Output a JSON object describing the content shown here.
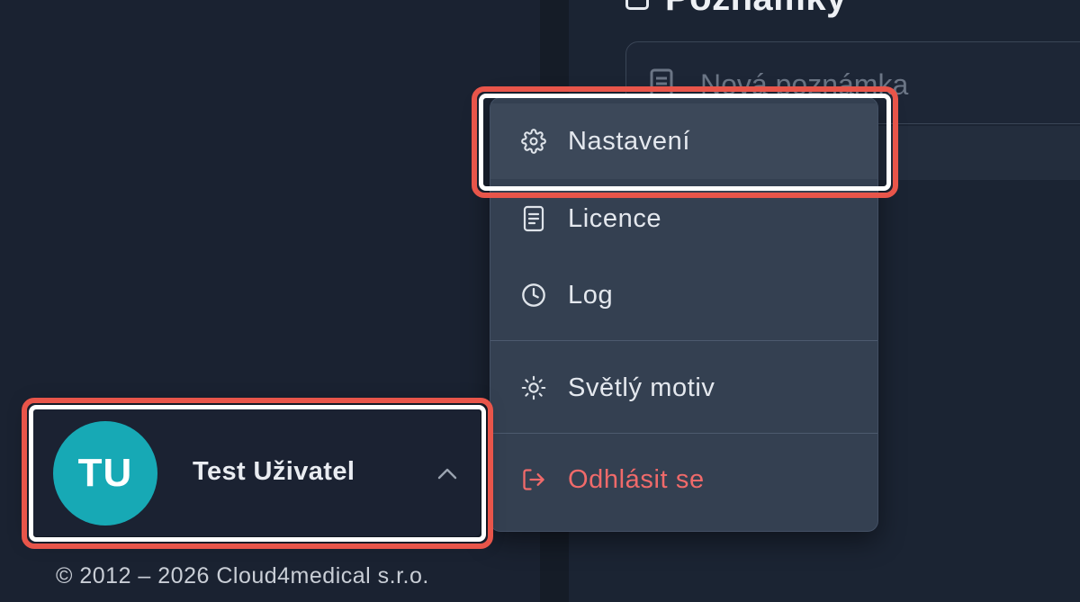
{
  "main": {
    "title": "Poznámky",
    "note_input": {
      "placeholder": "Nová poznámka"
    }
  },
  "user_menu": {
    "items": [
      {
        "label": "Nastavení",
        "icon": "gear-icon"
      },
      {
        "label": "Licence",
        "icon": "document-icon"
      },
      {
        "label": "Log",
        "icon": "clock-icon"
      },
      {
        "label": "Světlý motiv",
        "icon": "sun-icon"
      },
      {
        "label": "Odhlásit se",
        "icon": "logout-icon"
      }
    ]
  },
  "user": {
    "initials": "TU",
    "name": "Test Uživatel",
    "chevron_icon": "chevron-up-icon"
  },
  "footer": {
    "copyright": "© 2012 – 2026 Cloud4medical s.r.o."
  },
  "colors": {
    "avatar": "#17a9b5",
    "danger": "#f06a6a",
    "highlight_annotation": "#e8554a"
  }
}
